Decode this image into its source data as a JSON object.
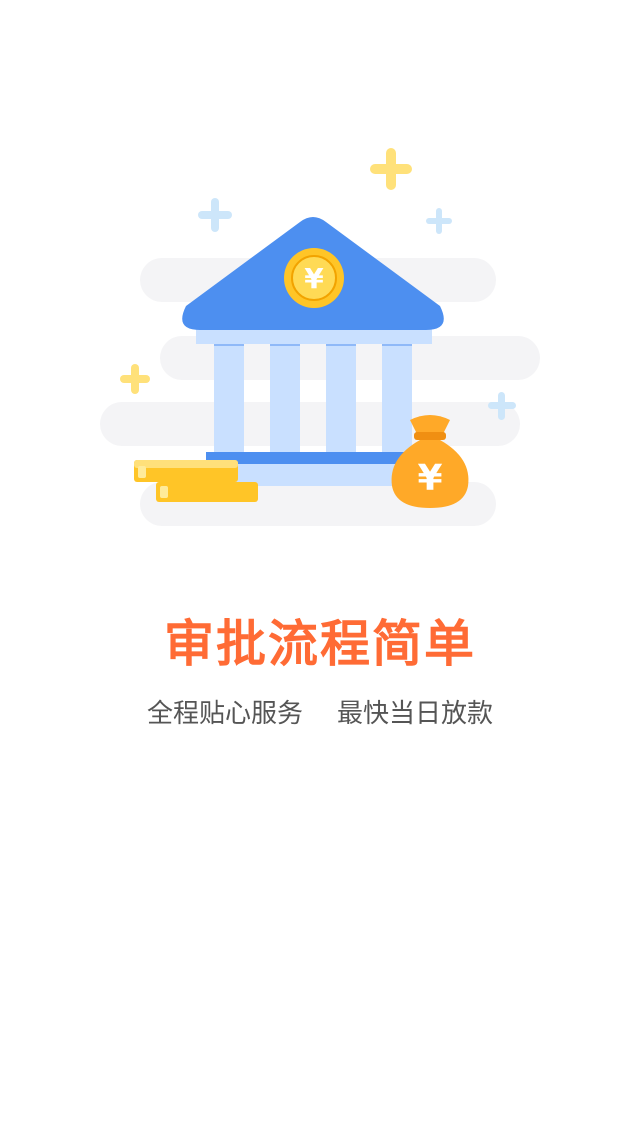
{
  "onboarding": {
    "headline": "审批流程简单",
    "subtitle_left": "全程贴心服务",
    "subtitle_right": "最快当日放款",
    "illustration": {
      "main_icon": "bank-building-icon",
      "coin_symbol": "¥",
      "bag_symbol": "¥",
      "decor_icons": [
        "sparkle-plus-icon",
        "coin-stack-icon",
        "money-bag-icon"
      ]
    }
  },
  "colors": {
    "headline": "#FF6B35",
    "subtitle": "#555555",
    "bank_roof": "#4D8FF0",
    "bank_columns": "#C9E0FF",
    "coin": "#FFC527",
    "money_bag": "#FFA928",
    "sparkle_yellow": "#FFE17A",
    "sparkle_blue": "#CDE6FA",
    "cloud": "#F4F4F6"
  }
}
